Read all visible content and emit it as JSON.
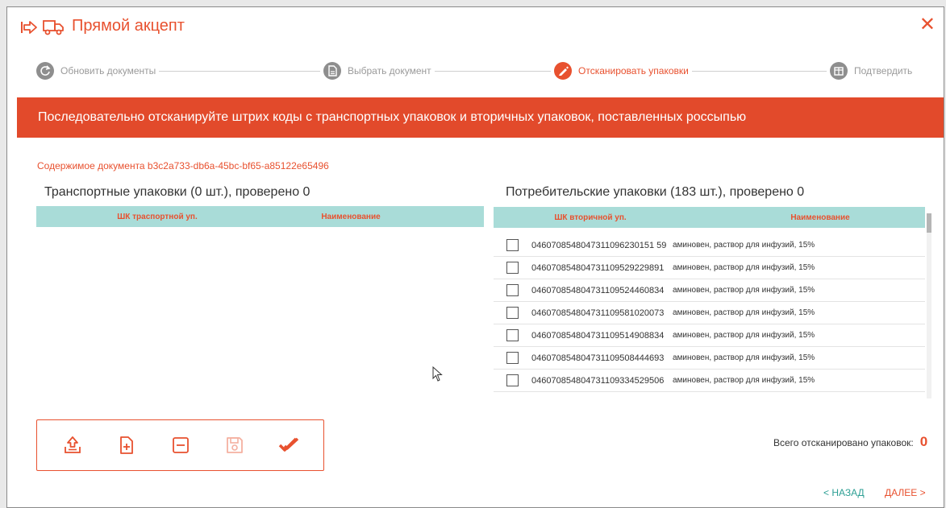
{
  "header": {
    "title": "Прямой акцепт",
    "close_symbol": "✕",
    "icons": [
      "arrow-in-icon",
      "truck-icon"
    ]
  },
  "steps": [
    {
      "label": "Обновить документы",
      "icon": "refresh-icon",
      "state": "done"
    },
    {
      "label": "Выбрать документ",
      "icon": "document-icon",
      "state": "done"
    },
    {
      "label": "Отсканировать упаковки",
      "icon": "pen-icon",
      "state": "active"
    },
    {
      "label": "Подтвердить",
      "icon": "box-icon",
      "state": "pending"
    }
  ],
  "banner": {
    "text": "Последовательно отсканируйте штрих коды с транспортных упаковок и вторичных упаковок, поставленных россыпью"
  },
  "document": {
    "label": "Содержимое документа b3c2a733-db6a-45bc-bf65-a85122e65496"
  },
  "transport": {
    "title": "Транспортные упаковки (0 шт.), проверено 0",
    "columns": [
      "ШК траспортной уп.",
      "Наименование"
    ]
  },
  "consumer": {
    "title": "Потребительские упаковки (183 шт.), проверено 0",
    "columns": [
      "ШК вторичной уп.",
      "Наименование"
    ],
    "rows": [
      {
        "code": "0460708548047311096230151 59",
        "name": "аминовен, раствор для инфузий, 15%"
      },
      {
        "code": "046070854804731109529229891",
        "name": "аминовен, раствор для инфузий, 15%"
      },
      {
        "code": "046070854804731109524460834",
        "name": "аминовен, раствор для инфузий, 15%"
      },
      {
        "code": "046070854804731109581020073",
        "name": "аминовен, раствор для инфузий, 15%"
      },
      {
        "code": "046070854804731109514908834",
        "name": "аминовен, раствор для инфузий, 15%"
      },
      {
        "code": "046070854804731109508444693",
        "name": "аминовен, раствор для инфузий, 15%"
      },
      {
        "code": "046070854804731109334529506",
        "name": "аминовен, раствор для инфузий, 15%"
      }
    ]
  },
  "toolbar": {
    "buttons": [
      {
        "icon": "upload-icon",
        "enabled": true
      },
      {
        "icon": "add-document-icon",
        "enabled": true
      },
      {
        "icon": "remove-icon",
        "enabled": true
      },
      {
        "icon": "save-icon",
        "enabled": false
      },
      {
        "icon": "double-check-icon",
        "enabled": true
      }
    ]
  },
  "total": {
    "label": "Всего отсканировано упаковок:",
    "count": "0"
  },
  "nav": {
    "back": "< НАЗАД",
    "next": "ДАЛЕЕ >"
  },
  "colors": {
    "accent": "#e8512f",
    "banner": "#e24a2b",
    "table_header": "#a9dcd8",
    "back_link": "#2d9f94"
  }
}
